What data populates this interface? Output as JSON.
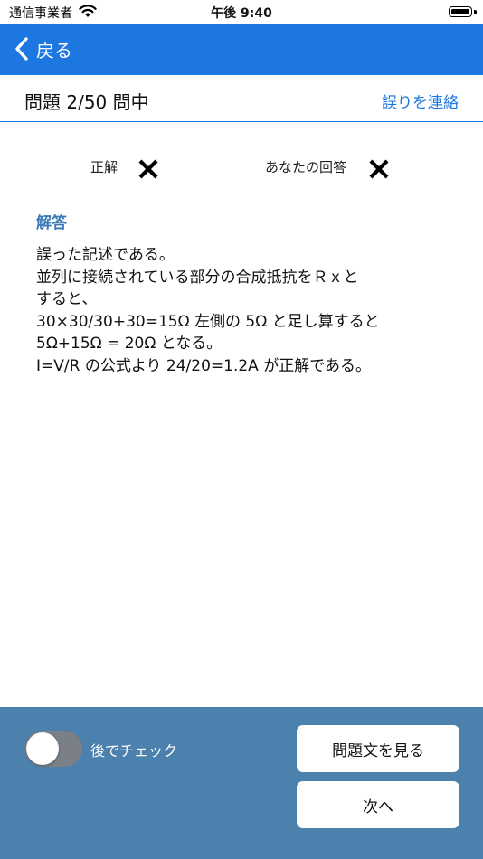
{
  "status_bar": {
    "carrier": "通信事業者",
    "time": "午後 9:40",
    "wifi_icon": "wifi-icon",
    "battery_icon": "battery-icon"
  },
  "nav": {
    "back_label": "戻る",
    "back_icon": "chevron-left-icon",
    "color": "#1c77e1"
  },
  "header": {
    "progress": "問題 2/50 問中",
    "report_link": "誤りを連絡"
  },
  "result": {
    "correct_label": "正解",
    "correct_mark_icon": "x-mark-icon",
    "your_answer_label": "あなたの回答",
    "your_answer_mark_icon": "x-mark-icon"
  },
  "answer": {
    "title": "解答",
    "lines": [
      "誤った記述である。",
      "並列に接続されている部分の合成抵抗をＲｘと",
      "すると、",
      "30×30/30+30=15Ω 左側の 5Ω と足し算すると",
      "5Ω+15Ω = 20Ω となる。",
      "I=V/R の公式より 24/20=1.2A が正解である。"
    ]
  },
  "footer": {
    "toggle_label": "後でチェック",
    "toggle_on": false,
    "view_question_button": "問題文を見る",
    "next_button": "次へ",
    "color": "#4c81ae"
  }
}
